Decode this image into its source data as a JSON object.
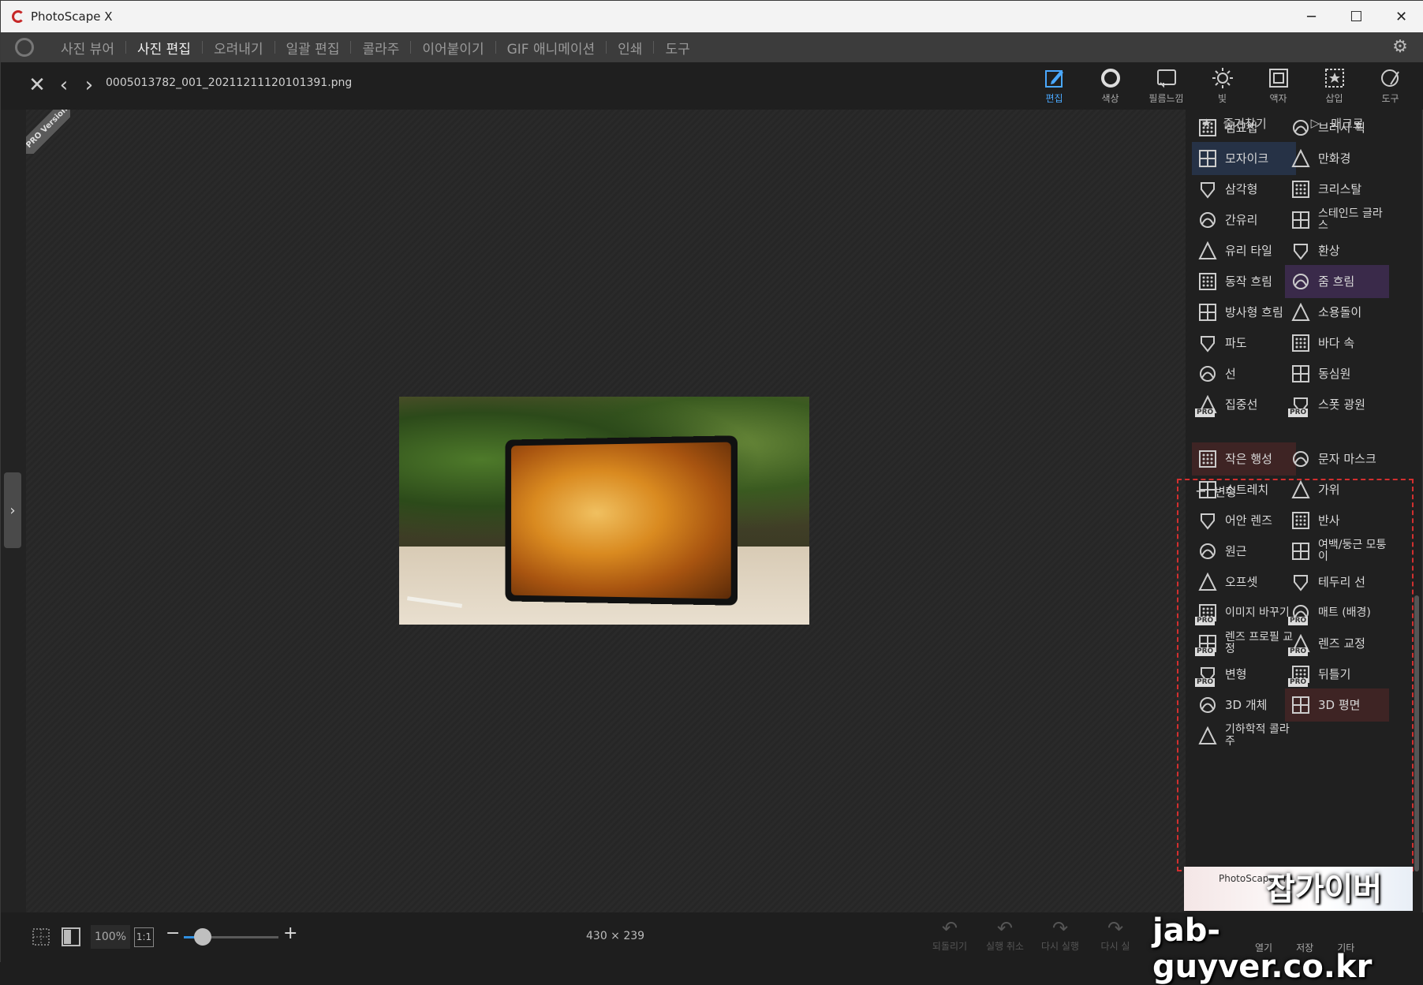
{
  "window": {
    "title": "PhotoScape X",
    "controls": [
      "─",
      "☐",
      "✕"
    ]
  },
  "menu": {
    "items": [
      {
        "label": "사진 뷰어",
        "active": false
      },
      {
        "label": "사진 편집",
        "active": true
      },
      {
        "label": "오려내기",
        "active": false
      },
      {
        "label": "일괄 편집",
        "active": false
      },
      {
        "label": "콜라주",
        "active": false
      },
      {
        "label": "이어붙이기",
        "active": false
      },
      {
        "label": "GIF 애니메이션",
        "active": false
      },
      {
        "label": "인쇄",
        "active": false
      },
      {
        "label": "도구",
        "active": false
      }
    ]
  },
  "toolbar": {
    "filename": "0005013782_001_20211211120101391.png",
    "tabs": [
      {
        "label": "편집",
        "icon": "edit-icon",
        "active": true
      },
      {
        "label": "색상",
        "icon": "color-circle-icon",
        "active": false
      },
      {
        "label": "필름느낌",
        "icon": "film-icon",
        "active": false
      },
      {
        "label": "빛",
        "icon": "light-icon",
        "active": false
      },
      {
        "label": "액자",
        "icon": "frame-icon",
        "active": false
      },
      {
        "label": "삽입",
        "icon": "insert-icon",
        "active": false
      },
      {
        "label": "도구",
        "icon": "tools-icon",
        "active": false
      }
    ]
  },
  "canvas": {
    "pro_badge": "PRO Version"
  },
  "panel": {
    "favorites": "즐겨찾기",
    "macro": "매크로",
    "effects": [
      [
        "점묘법",
        "브러시 획"
      ],
      [
        "모자이크",
        "만화경"
      ],
      [
        "삼각형",
        "크리스탈"
      ],
      [
        "간유리",
        "스테인드 글라스"
      ],
      [
        "유리 타일",
        "환상"
      ],
      [
        "동작 흐림",
        "줌 흐림"
      ],
      [
        "방사형 흐림",
        "소용돌이"
      ],
      [
        "파도",
        "바다 속"
      ],
      [
        "선",
        "동심원"
      ],
      [
        "집중선",
        "스폿 광원"
      ]
    ],
    "transform_title": "변형",
    "transforms": [
      [
        "작은 행성",
        "문자 마스크"
      ],
      [
        "스트레치",
        "가위"
      ],
      [
        "어안 렌즈",
        "반사"
      ],
      [
        "원근",
        "여백/둥근 모퉁이"
      ],
      [
        "오프셋",
        "테두리 선"
      ],
      [
        "이미지 바꾸기",
        "매트 (배경)"
      ],
      [
        "렌즈 프로필 교정",
        "렌즈 교정"
      ],
      [
        "변형",
        "뒤틀기"
      ],
      [
        "3D 개체",
        "3D 평면"
      ],
      [
        "기하학적 콜라주",
        ""
      ]
    ],
    "ad_text": "PhotoScape Pro"
  },
  "status": {
    "zoom": "100%",
    "one_to_one": "1:1",
    "zoom_level": 0.2,
    "image_size": "430 × 239",
    "undo_actions": [
      {
        "label": "되돌리기",
        "icon": "↶"
      },
      {
        "label": "실행 취소",
        "icon": "↶"
      },
      {
        "label": "다시 실행",
        "icon": "↷"
      },
      {
        "label": "다시 실",
        "icon": "↷"
      }
    ],
    "bottom_right": [
      "열기",
      "저장",
      "기타"
    ]
  },
  "watermark": {
    "korean": "잡가이버",
    "url": "jab-guyver.co.kr"
  },
  "colors": {
    "accent": "#4aa8ff",
    "highlight_red": "#d32f2f"
  }
}
